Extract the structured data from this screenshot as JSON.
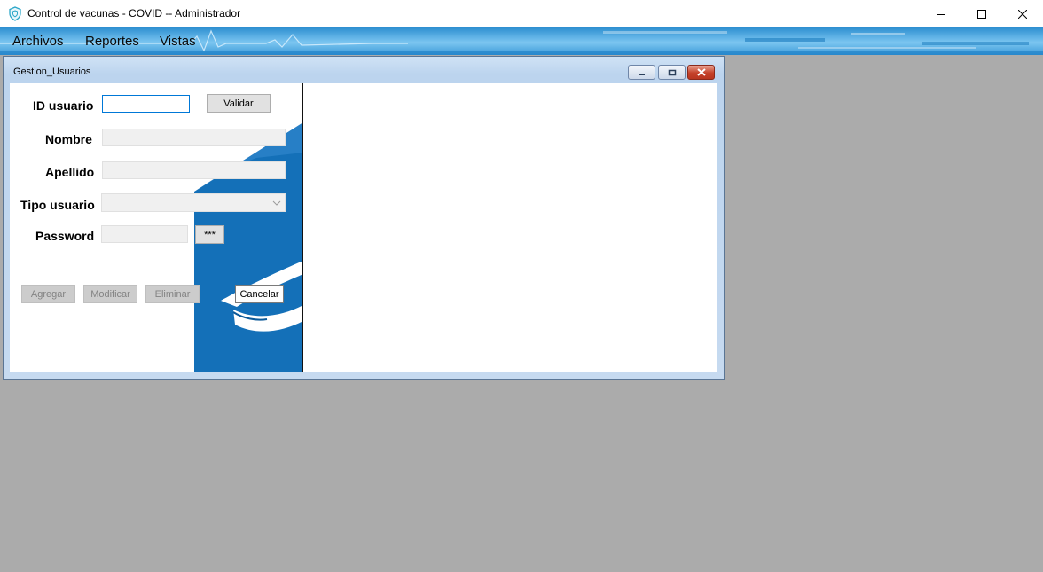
{
  "window": {
    "title": "Control de vacunas - COVID -- Administrador",
    "icon": "shield-icon",
    "controls": [
      "minimize-icon",
      "maximize-icon",
      "close-icon"
    ]
  },
  "menu": {
    "items": [
      "Archivos",
      "Reportes",
      "Vistas"
    ]
  },
  "child_window": {
    "title": "Gestion_Usuarios",
    "controls": [
      "minimize-icon",
      "restore-icon",
      "close-icon"
    ]
  },
  "form": {
    "labels": {
      "id_usuario": "ID usuario",
      "nombre": "Nombre",
      "apellido": "Apellido",
      "tipo_usuario": "Tipo usuario",
      "password": "Password"
    },
    "values": {
      "id_usuario": "",
      "nombre": "",
      "apellido": "",
      "tipo_usuario": "",
      "password": ""
    },
    "buttons": {
      "validar": "Validar",
      "show_password": "***",
      "agregar": "Agregar",
      "modificar": "Modificar",
      "eliminar": "Eliminar",
      "cancelar": "Cancelar"
    }
  },
  "colors": {
    "workspace": "#ababab",
    "panel_blue": "#1470b8",
    "focus_border": "#0078d7"
  }
}
